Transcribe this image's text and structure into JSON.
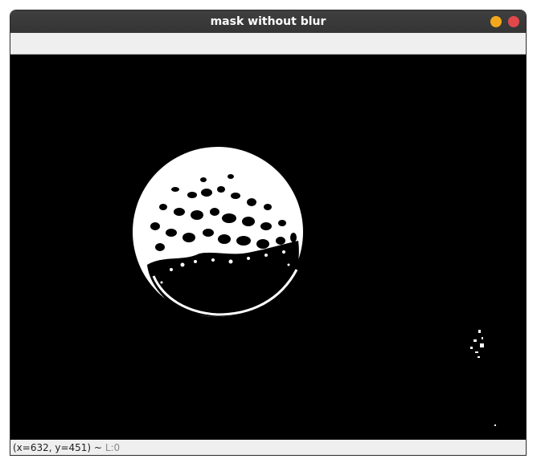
{
  "window": {
    "title": "mask without blur"
  },
  "status": {
    "coords": "(x=632, y=451) ~",
    "level": "L:0"
  },
  "image": {
    "description_icon": "binary-mask-image",
    "foreground": "#ffffff",
    "background": "#000000"
  },
  "colors": {
    "titlebar": "#383838",
    "minimize": "#f3a81c",
    "close": "#e0484a"
  }
}
